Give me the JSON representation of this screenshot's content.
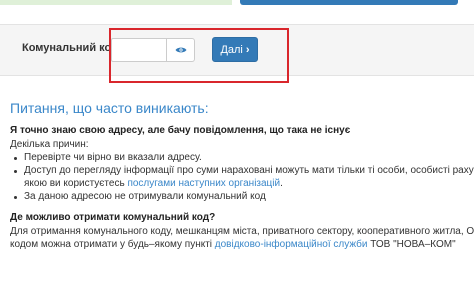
{
  "code_form": {
    "label": "Комунальний код:",
    "input_value": "",
    "next_label": "Далі",
    "eye_icon": "eye-icon",
    "chevron_icon": "chevron-right-icon",
    "accent_color": "#337ab7",
    "highlight_color": "#d9262c"
  },
  "faq": {
    "title": "Питання, що часто виникають:",
    "q1": {
      "question": "Я точно знаю свою адресу, але бачу повідомлення, що така не існує",
      "intro": "Декілька причин:",
      "reason1": "Перевірте чи вірно ви вказали адресу.",
      "reason2_line1": "Доступ до перегляду інформації про суми нараховані можуть мати тільки ті особи, особисті рахунки",
      "reason2_line2_before": "якою ви користуєтесь ",
      "reason2_link": "послугами наступних організацій",
      "reason2_line2_after": ".",
      "reason3": "За даною адресою не отримували комунальний код"
    },
    "q2": {
      "question": "Де можливо отримати комунальний код?",
      "line1": "Для отримання комунального коду, мешканцям міста, приватного сектору, кооперативного житла, ОСББ,",
      "line2_before": "кодом можна отримати у будь–якому пункті ",
      "line2_link": "довідково-інформаційної служби",
      "line2_after": " ТОВ \"НОВА–КОМ\""
    }
  }
}
